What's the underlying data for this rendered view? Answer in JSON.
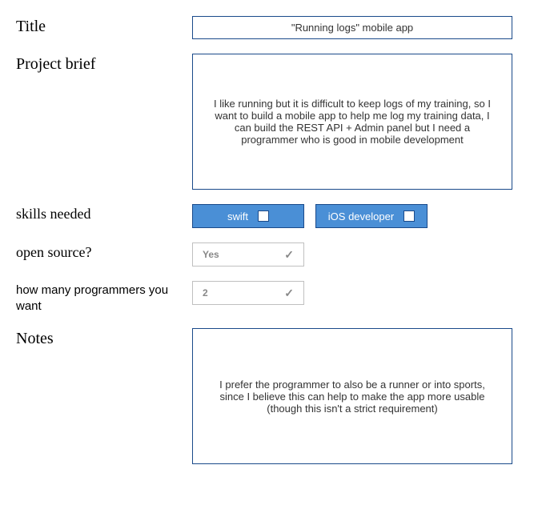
{
  "title": {
    "label": "Title",
    "value": "\"Running logs\" mobile app"
  },
  "project_brief": {
    "label": "Project brief",
    "value": "I like running but it is difficult to keep logs of my training, so I want to build a mobile app to help me log my training data, I can build the REST API + Admin panel but I need a programmer who is good in mobile development"
  },
  "skills_needed": {
    "label": "skills needed",
    "skills": [
      {
        "label": "swift"
      },
      {
        "label": "iOS developer"
      }
    ]
  },
  "open_source": {
    "label": "open source?",
    "value": "Yes",
    "check": "✓"
  },
  "programmers": {
    "label": "how many programmers you want",
    "value": "2",
    "check": "✓"
  },
  "notes": {
    "label": "Notes",
    "value": "I prefer the programmer to also be a runner or into sports, since I believe this can help to make the app more usable (though this isn't a strict requirement)"
  }
}
